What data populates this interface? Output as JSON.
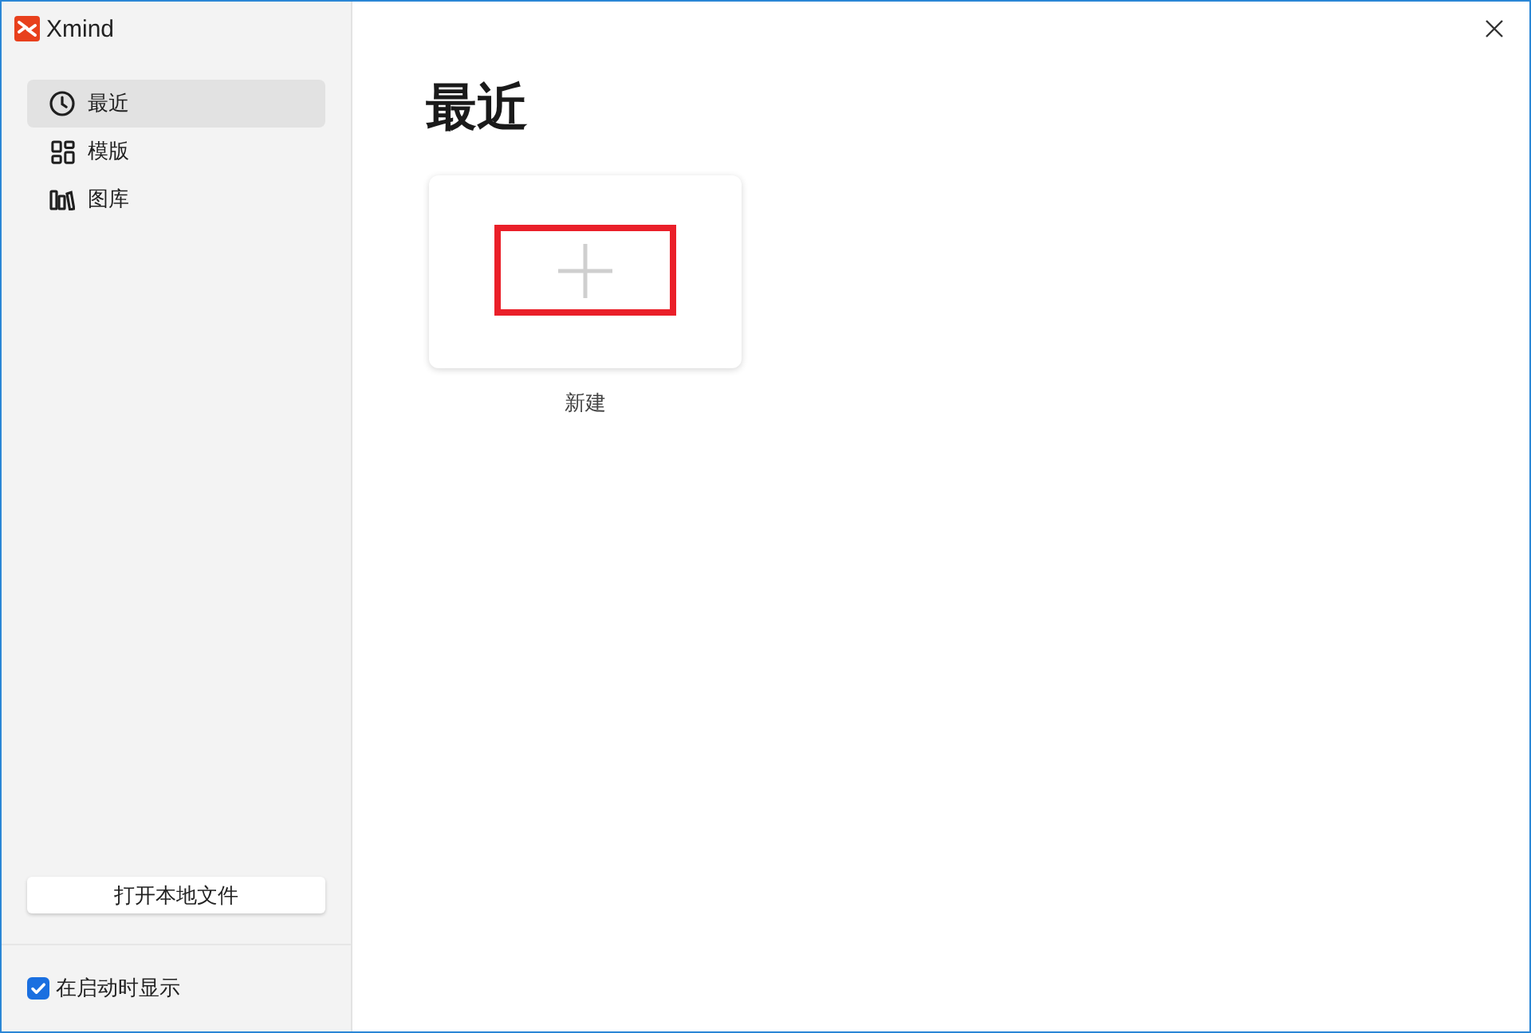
{
  "window": {
    "app_name": "Xmind"
  },
  "sidebar": {
    "items": [
      {
        "label": "最近",
        "kind": "recent",
        "selected": true
      },
      {
        "label": "模版",
        "kind": "templates",
        "selected": false
      },
      {
        "label": "图库",
        "kind": "gallery",
        "selected": false
      }
    ],
    "open_button": {
      "label": "打开本地文件"
    },
    "startup_checkbox": {
      "label": "在启动时显示",
      "checked": true
    }
  },
  "main": {
    "heading": "最近",
    "new_card": {
      "label": "新建",
      "highlighted": true
    }
  }
}
